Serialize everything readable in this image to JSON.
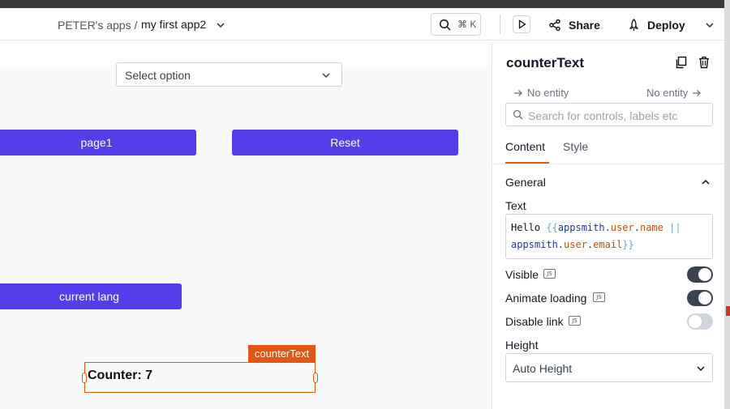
{
  "header": {
    "breadcrumb_root": "PETER's apps /",
    "app_name": "my first app2",
    "search_shortcut": "⌘ K",
    "share_label": "Share",
    "deploy_label": "Deploy"
  },
  "canvas": {
    "select": {
      "placeholder": "Select option"
    },
    "buttons": {
      "page1": "page1",
      "reset": "Reset",
      "current_lang": "current lang"
    },
    "selected_widget": {
      "tag": "counterText",
      "text": "Counter: 7"
    }
  },
  "panel": {
    "title": "counterText",
    "entity_left": "No entity",
    "entity_right": "No entity",
    "search_placeholder": "Search for controls, labels etc",
    "tabs": [
      "Content",
      "Style"
    ],
    "section": "General",
    "text_label": "Text",
    "text_value": {
      "hello": "Hello ",
      "open": "{{",
      "obj1": "appsmith",
      "dot": ".",
      "user1": "user",
      "name": "name",
      "or": " ||",
      "obj2": "appsmith",
      "user2": "user",
      "email": "email",
      "close": "}}"
    },
    "js_badge": "JS",
    "properties": [
      {
        "label": "Visible",
        "on": true
      },
      {
        "label": "Animate loading",
        "on": true
      },
      {
        "label": "Disable link",
        "on": false
      }
    ],
    "height_label": "Height",
    "height_value": "Auto Height"
  },
  "colors": {
    "primary_button": "#553de9",
    "selection": "#e15615",
    "toggle_on": "#3b4252"
  }
}
